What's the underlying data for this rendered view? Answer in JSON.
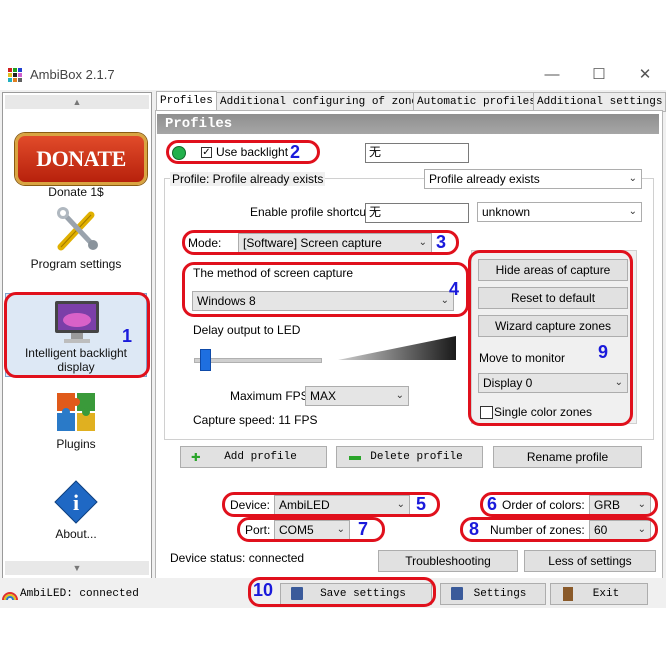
{
  "window": {
    "title": "AmbiBox 2.1.7",
    "minimize": "—",
    "maximize": "☐",
    "close": "✕"
  },
  "sidebar": {
    "donate_logo": "DONATE NOW",
    "items": [
      {
        "label": "Donate 1$"
      },
      {
        "label": "Program settings"
      },
      {
        "label": "Intelligent backlight display"
      },
      {
        "label": "Plugins"
      },
      {
        "label": "About..."
      }
    ]
  },
  "tabs": [
    "Profiles",
    "Additional configuring of zones",
    "Automatic profiles",
    "Additional settings"
  ],
  "panel": {
    "heading": "Profiles"
  },
  "profiles": {
    "use_backlight": "Use backlight",
    "profile_name_value": "无",
    "profile_status": "Profile: Profile already exists",
    "profile_combo": "Profile already exists",
    "shortcut_label": "Enable profile shortcut:",
    "shortcut_value": "无",
    "shortcut_combo": "unknown",
    "mode_label": "Mode:",
    "mode_value": "[Software] Screen capture",
    "method_label": "The method of screen capture",
    "method_value": "Windows 8",
    "delay_label": "Delay output to LED",
    "delay_level": 0.08,
    "fps_label": "Maximum FPS",
    "fps_value": "MAX",
    "capture_speed": "Capture speed: 11 FPS",
    "hide_areas": "Hide areas of capture",
    "reset_default": "Reset to default",
    "wizard_zones": "Wizard capture zones",
    "move_monitor_label": "Move to monitor",
    "monitor_value": "Display 0",
    "single_color": "Single color zones",
    "add_profile": "Add profile",
    "delete_profile": "Delete profile",
    "rename_profile": "Rename profile"
  },
  "device": {
    "device_label": "Device:",
    "device_value": "AmbiLED",
    "port_label": "Port:",
    "port_value": "COM5",
    "order_label": "Order of colors:",
    "order_value": "GRB",
    "zones_label": "Number of zones:",
    "zones_value": "60",
    "status": "Device status: connected",
    "troubleshooting": "Troubleshooting",
    "less_settings": "Less of settings"
  },
  "statusbar": {
    "status_text": "AmbiLED: connected",
    "save_settings": "Save settings",
    "settings": "Settings",
    "exit": "Exit"
  },
  "annotations": [
    "1",
    "2",
    "3",
    "4",
    "5",
    "6",
    "7",
    "8",
    "9",
    "10"
  ],
  "colors": {
    "annotation_red": "#e0101c",
    "annotation_blue": "#1a1adb",
    "status_green": "#22b14c"
  }
}
